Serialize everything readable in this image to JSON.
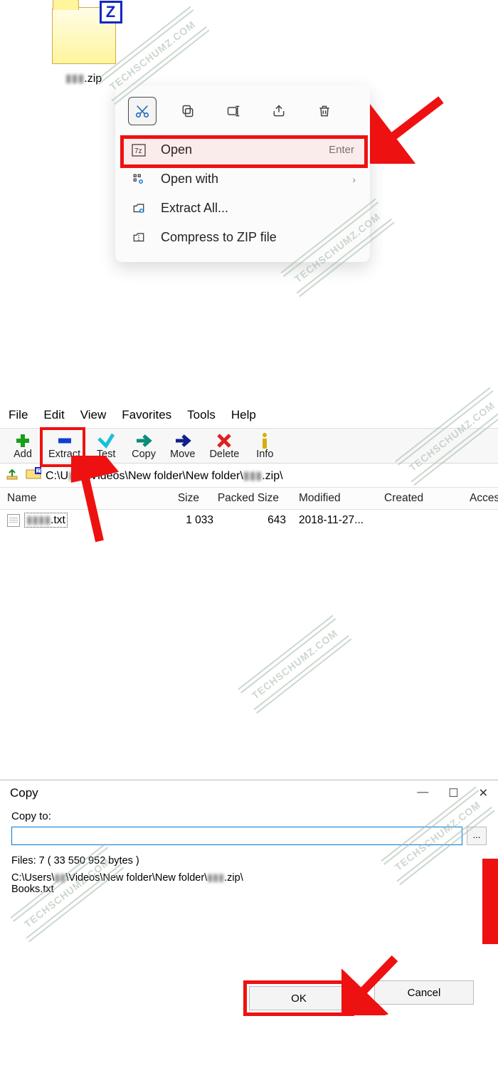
{
  "watermark": "TECHSCHUMZ.COM",
  "section1": {
    "zip_file_label": ".zip",
    "ctx_icons": [
      "cut",
      "copy",
      "rename",
      "share",
      "delete"
    ],
    "menu": {
      "open": {
        "label": "Open",
        "shortcut": "Enter"
      },
      "open_with": {
        "label": "Open with"
      },
      "extract_all": {
        "label": "Extract All..."
      },
      "compress": {
        "label": "Compress to ZIP file"
      }
    }
  },
  "section2": {
    "menubar": [
      "File",
      "Edit",
      "View",
      "Favorites",
      "Tools",
      "Help"
    ],
    "toolbar": {
      "add": "Add",
      "extract": "Extract",
      "test": "Test",
      "copy": "Copy",
      "move": "Move",
      "delete": "Delete",
      "info": "Info"
    },
    "path_prefix": "C:\\U",
    "path_mid": "\\Videos\\New folder\\New folder\\",
    "path_suffix": ".zip\\",
    "columns": {
      "name": "Name",
      "size": "Size",
      "packed": "Packed Size",
      "modified": "Modified",
      "created": "Created",
      "accessed": "Acces"
    },
    "row": {
      "name_suffix": ".txt",
      "size": "1 033",
      "packed": "643",
      "modified": "2018-11-27..."
    }
  },
  "section3": {
    "title": "Copy",
    "label_copyto": "Copy to:",
    "input_value": "",
    "browse_label": "...",
    "files_line": "Files: 7 ( 33 550 952 bytes )",
    "path_line_prefix": "C:\\Users\\",
    "path_line_mid": "\\Videos\\New folder\\New folder\\",
    "path_line_suffix": ".zip\\",
    "file_listed": "Books.txt",
    "ok": "OK",
    "cancel": "Cancel"
  }
}
